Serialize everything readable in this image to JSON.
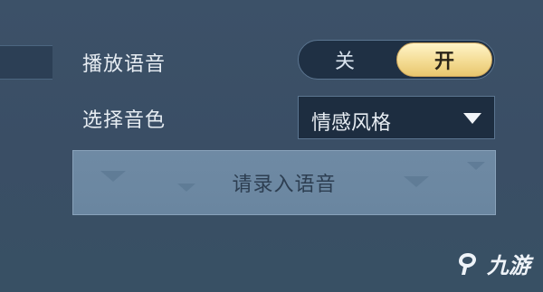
{
  "settings": {
    "voice_label": "播放语音",
    "toggle": {
      "off_label": "关",
      "on_label": "开",
      "state": "on"
    },
    "tone_label": "选择音色",
    "tone_select": {
      "value": "情感风格"
    },
    "record_button_label": "请录入语音"
  },
  "watermark": {
    "text": "九游",
    "icon": "nine-game-logo-icon"
  },
  "colors": {
    "background": "#3a4f66",
    "toggle_on": "#f4dc94",
    "select_bg": "#1d2d40",
    "record_bg": "#6f8aa4"
  }
}
